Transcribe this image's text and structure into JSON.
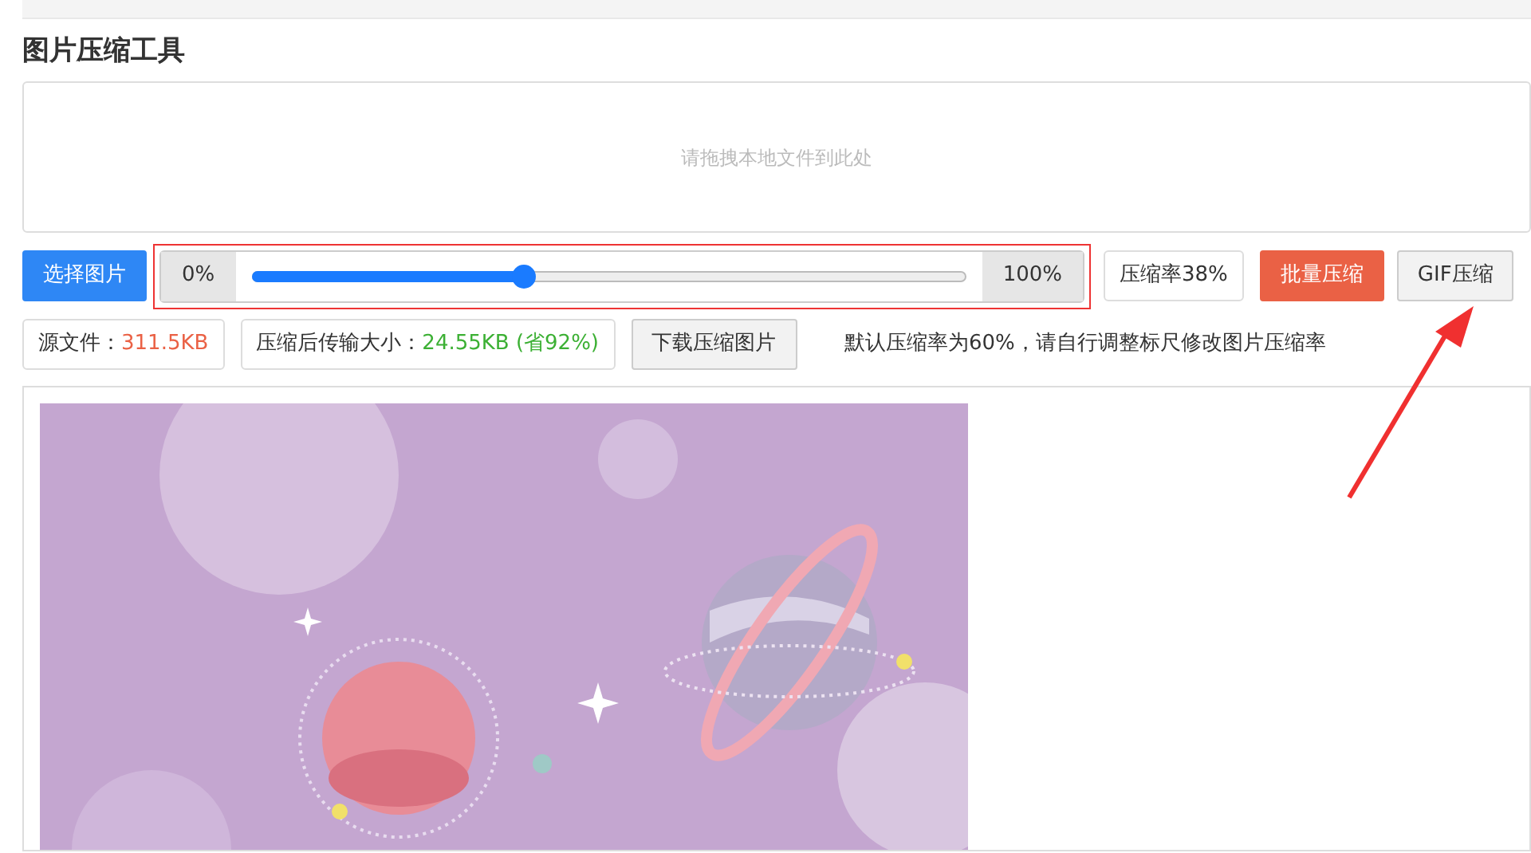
{
  "title": "图片压缩工具",
  "drop_zone": {
    "placeholder": "请拖拽本地文件到此处"
  },
  "choose_button": "选择图片",
  "slider": {
    "min_label": "0%",
    "max_label": "100%",
    "level": 0.38
  },
  "rate_label": "压缩率38%",
  "batch_button": "批量压缩",
  "gif_button": "GIF压缩",
  "source": {
    "label": "源文件：",
    "value": "311.5KB"
  },
  "compressed": {
    "label": "压缩后传输大小：",
    "value": "24.55KB (省92%)"
  },
  "download_button": "下载压缩图片",
  "hint": "默认压缩率为60%，请自行调整标尺修改图片压缩率"
}
